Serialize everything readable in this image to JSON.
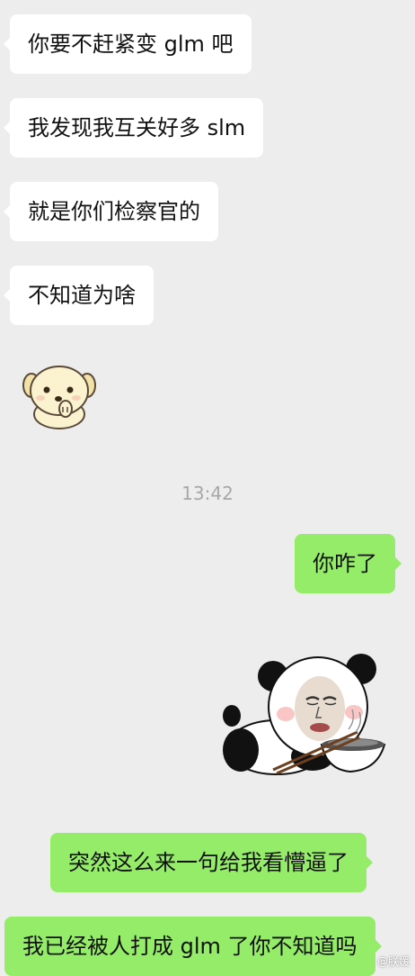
{
  "messages": {
    "m1": "你要不赶紧变 glm 吧",
    "m2": "我发现我互关好多 slm",
    "m3": "就是你们检察官的",
    "m4": "不知道为啥",
    "timestamp": "13:42",
    "m5": "你咋了",
    "m6": "突然这么来一句给我看懵逼了",
    "m7": "我已经被人打成 glm 了你不知道吗"
  },
  "stickers": {
    "dog": "cream-puppy-sticker",
    "panda": "panda-meme-sticker"
  },
  "watermark": "@朕媛",
  "colors": {
    "background": "#ededed",
    "incoming_bubble": "#ffffff",
    "outgoing_bubble": "#95ec69",
    "timestamp_text": "#a8a8a8"
  }
}
